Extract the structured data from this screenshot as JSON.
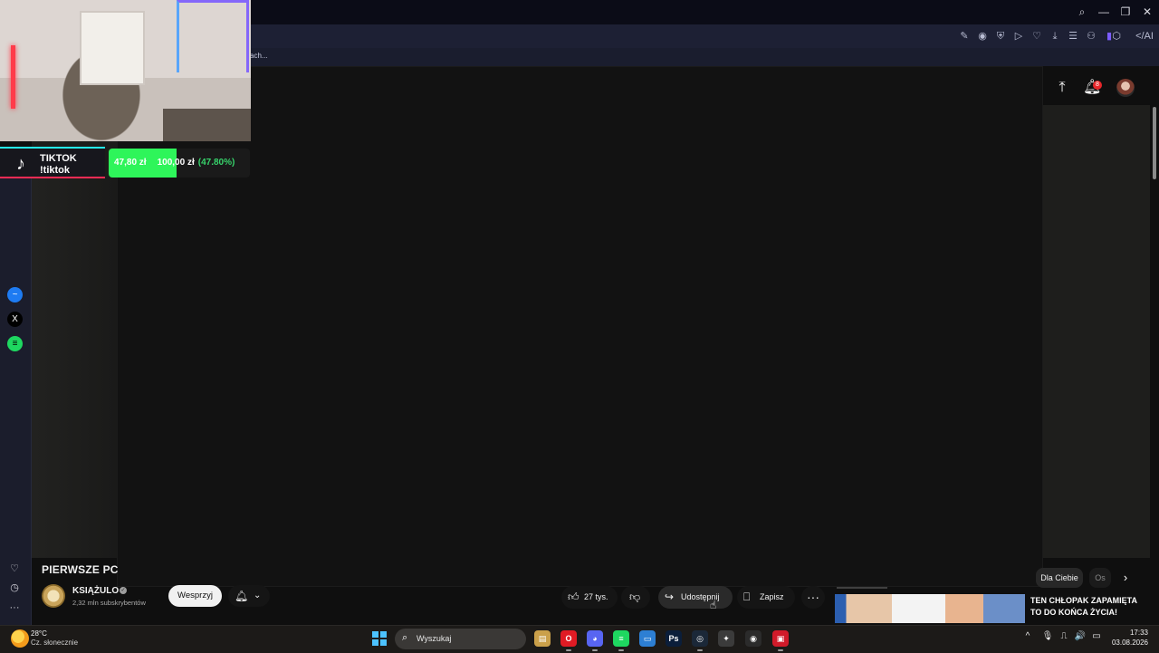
{
  "browser": {
    "window_controls": {
      "search": "⌕",
      "minimize": "—",
      "restore": "❐",
      "close": "✕"
    },
    "toolbar_icons": [
      "✎",
      "◉",
      "⛨",
      "▷",
      "♡",
      "⤓",
      "☰",
      "⚇",
      "▮",
      "⬡",
      "</AI"
    ],
    "bookmark_text": "ach...",
    "sidebar_icons": [
      {
        "name": "messenger-icon",
        "glyph": "~",
        "color": "#1e7bf2"
      },
      {
        "name": "x-icon",
        "glyph": "X",
        "color": "#000000"
      },
      {
        "name": "spotify-icon",
        "glyph": "≡",
        "color": "#1ed760"
      }
    ],
    "sidebar_bottom_icons": [
      "♡",
      "◷",
      "···"
    ]
  },
  "youtube": {
    "notifications_count": "8",
    "video_title": "PIERWSZE PC",
    "channel": {
      "name": "KSIĄŻULO",
      "subscribers": "2,32 mln subskrybentów"
    },
    "support_label": "Wesprzyj",
    "actions": {
      "likes": "27 tys.",
      "share_label": "Udostępnij",
      "save_label": "Zapisz",
      "more": "···"
    },
    "chips": {
      "for_you": "Dla Ciebie",
      "other": "Os"
    },
    "recommendation": {
      "title": "TEN CHŁOPAK ZAPAMIĘTA TO DO KOŃCA ŻYCIA!"
    }
  },
  "stream_overlay": {
    "tiktok": {
      "name": "TIKTOK",
      "command": "!tiktok"
    },
    "goal": {
      "current": "47,80 zł",
      "target": "100,00 zł",
      "percent_label": "(47.80%)",
      "fraction": 0.478
    }
  },
  "taskbar": {
    "weather": {
      "temp": "28°C",
      "desc": "Cz. słonecznie"
    },
    "search_placeholder": "Wyszukaj",
    "apps": [
      {
        "name": "file-explorer-icon",
        "glyph": "▤",
        "bg": "#caa04a"
      },
      {
        "name": "opera-icon",
        "glyph": "O",
        "bg": "#e01b24"
      },
      {
        "name": "discord-icon",
        "glyph": "◕",
        "bg": "#5865f2"
      },
      {
        "name": "spotify-icon",
        "glyph": "≡",
        "bg": "#1ed760"
      },
      {
        "name": "monitor-icon",
        "glyph": "▭",
        "bg": "#2d7fd3"
      },
      {
        "name": "photoshop-icon",
        "glyph": "Ps",
        "bg": "#0b1e3a"
      },
      {
        "name": "steam-icon",
        "glyph": "◎",
        "bg": "#1b2838"
      },
      {
        "name": "davinci-icon",
        "glyph": "✦",
        "bg": "#3b3b3b"
      },
      {
        "name": "obs-icon",
        "glyph": "◉",
        "bg": "#2b2b2b"
      },
      {
        "name": "red-app-icon",
        "glyph": "▣",
        "bg": "#d11a2a"
      }
    ],
    "tray": [
      "^",
      "🎙",
      "⎍",
      "🔊",
      "▭"
    ],
    "time": "17:33",
    "date": "03.08.2026"
  }
}
